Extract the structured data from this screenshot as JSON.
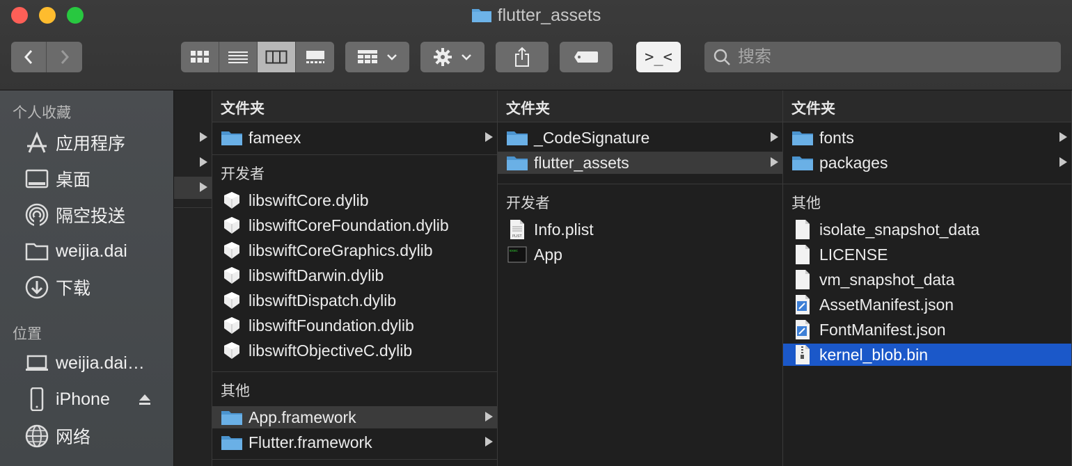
{
  "window": {
    "title": "flutter_assets"
  },
  "toolbar": {
    "back_label": "‹",
    "forward_label": "›",
    "search_placeholder": "搜索",
    "terminal_label": ">_<"
  },
  "sidebar": {
    "favorites_label": "个人收藏",
    "favorites": [
      {
        "label": "应用程序",
        "icon": "applications-icon"
      },
      {
        "label": "桌面",
        "icon": "desktop-icon"
      },
      {
        "label": "隔空投送",
        "icon": "airdrop-icon"
      },
      {
        "label": "weijia.dai",
        "icon": "home-folder-icon"
      },
      {
        "label": "下载",
        "icon": "downloads-icon"
      }
    ],
    "locations_label": "位置",
    "locations": [
      {
        "label": "weijia.dai…",
        "icon": "laptop-icon"
      },
      {
        "label": "iPhone",
        "icon": "iphone-icon"
      },
      {
        "label": "网络",
        "icon": "network-icon"
      }
    ]
  },
  "columns": {
    "col1": {
      "header": "文件夹",
      "folders": [
        {
          "label": "fameex"
        }
      ],
      "dev_label": "开发者",
      "dev_items": [
        {
          "label": "libswiftCore.dylib"
        },
        {
          "label": "libswiftCoreFoundation.dylib"
        },
        {
          "label": "libswiftCoreGraphics.dylib"
        },
        {
          "label": "libswiftDarwin.dylib"
        },
        {
          "label": "libswiftDispatch.dylib"
        },
        {
          "label": "libswiftFoundation.dylib"
        },
        {
          "label": "libswiftObjectiveC.dylib"
        }
      ],
      "other_label": "其他",
      "other_items": [
        {
          "label": "App.framework"
        },
        {
          "label": "Flutter.framework"
        }
      ]
    },
    "col2": {
      "header": "文件夹",
      "folders": [
        {
          "label": "_CodeSignature"
        },
        {
          "label": "flutter_assets"
        }
      ],
      "dev_label": "开发者",
      "dev_items": [
        {
          "label": "Info.plist"
        },
        {
          "label": "App"
        }
      ]
    },
    "col3": {
      "header": "文件夹",
      "folders": [
        {
          "label": "fonts"
        },
        {
          "label": "packages"
        }
      ],
      "other_label": "其他",
      "other_items": [
        {
          "label": "isolate_snapshot_data"
        },
        {
          "label": "LICENSE"
        },
        {
          "label": "vm_snapshot_data"
        },
        {
          "label": "AssetManifest.json"
        },
        {
          "label": "FontManifest.json"
        },
        {
          "label": "kernel_blob.bin"
        }
      ]
    }
  },
  "colors": {
    "selection_blue": "#1b58c9",
    "folder_blue": "#5aa3dc"
  }
}
